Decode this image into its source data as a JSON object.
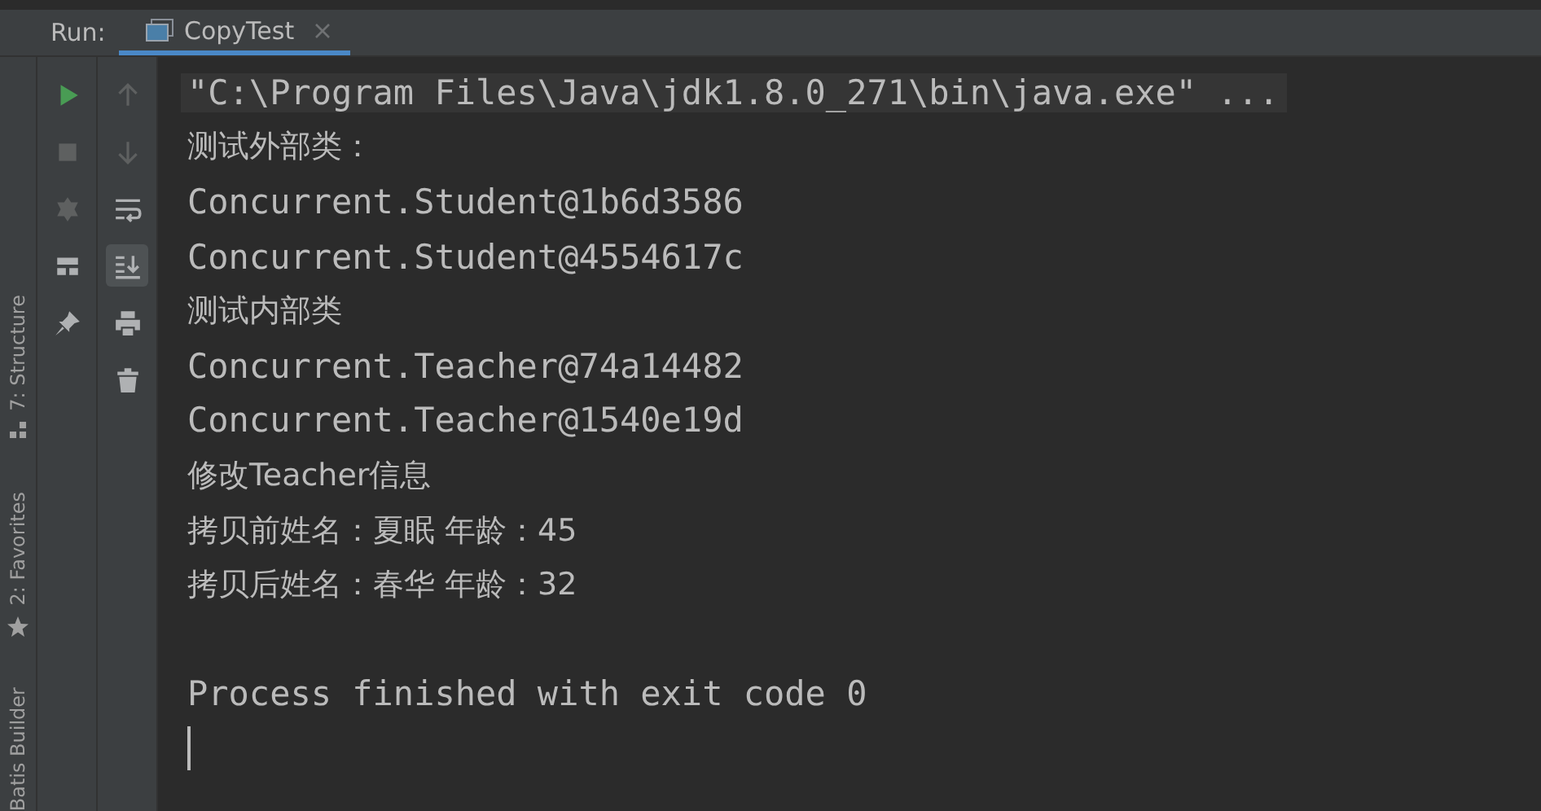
{
  "run_bar": {
    "label": "Run:",
    "tabs": [
      {
        "title": "CopyTest",
        "selected": true
      }
    ]
  },
  "side_stripe": [
    {
      "text": "7: Structure",
      "kind": "structure"
    },
    {
      "text": "2: Favorites",
      "kind": "favorites"
    },
    {
      "text": "Batis Builder",
      "kind": "plain"
    }
  ],
  "toolbar_left": [
    {
      "kind": "run",
      "disabled": false
    },
    {
      "kind": "stop",
      "disabled": true
    },
    {
      "kind": "debug",
      "disabled": true
    },
    {
      "kind": "layout",
      "disabled": false
    },
    {
      "kind": "pin",
      "disabled": false
    }
  ],
  "toolbar_right": [
    {
      "kind": "up",
      "disabled": true,
      "selected": false
    },
    {
      "kind": "down",
      "disabled": true,
      "selected": false
    },
    {
      "kind": "wrap",
      "disabled": false,
      "selected": false
    },
    {
      "kind": "scroll-end",
      "disabled": false,
      "selected": true
    },
    {
      "kind": "print",
      "disabled": false,
      "selected": false
    },
    {
      "kind": "trash",
      "disabled": false,
      "selected": false
    }
  ],
  "console": [
    {
      "kind": "command",
      "text": "\"C:\\Program Files\\Java\\jdk1.8.0_271\\bin\\java.exe\" ..."
    },
    {
      "kind": "text",
      "text": "测试外部类："
    },
    {
      "kind": "text",
      "text": "Concurrent.Student@1b6d3586"
    },
    {
      "kind": "text",
      "text": "Concurrent.Student@4554617c"
    },
    {
      "kind": "text",
      "text": "测试内部类"
    },
    {
      "kind": "text",
      "text": "Concurrent.Teacher@74a14482"
    },
    {
      "kind": "text",
      "text": "Concurrent.Teacher@1540e19d"
    },
    {
      "kind": "text",
      "text": "修改Teacher信息"
    },
    {
      "kind": "text",
      "text": "拷贝前姓名：夏眠 年龄：45"
    },
    {
      "kind": "text",
      "text": "拷贝后姓名：春华 年龄：32"
    },
    {
      "kind": "blank"
    },
    {
      "kind": "text",
      "text": "Process finished with exit code 0"
    },
    {
      "kind": "cursor"
    }
  ]
}
